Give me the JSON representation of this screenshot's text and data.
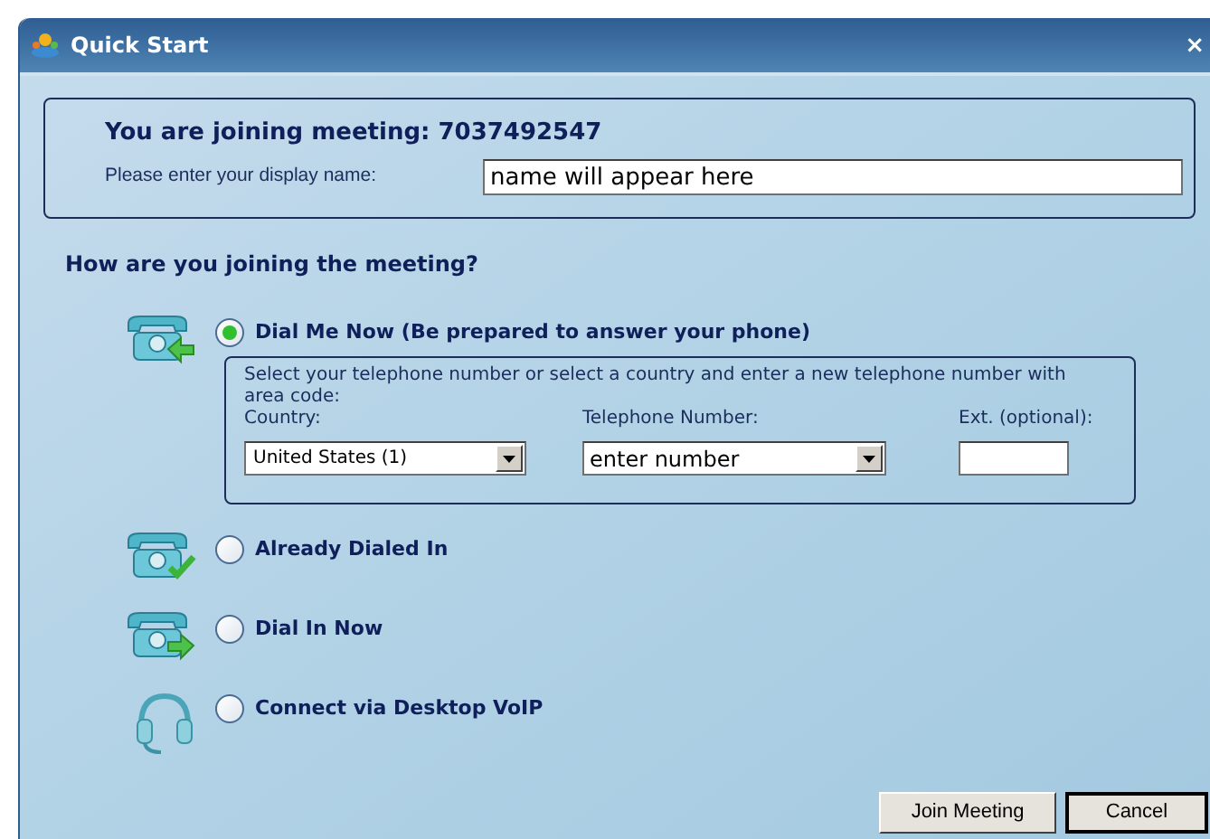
{
  "window": {
    "title": "Quick Start",
    "close": "×"
  },
  "meeting": {
    "heading": "You are joining meeting: 7037492547",
    "name_label": "Please enter your display name:",
    "name_value": "name will appear here"
  },
  "question": "How are you joining the meeting?",
  "options": [
    {
      "kind": "dial-me",
      "label": "Dial Me Now (Be prepared to answer your phone)",
      "selected": true,
      "details": {
        "instructions": "Select your telephone number or select a country and enter a new telephone number with area code:",
        "country_label": "Country:",
        "country_value": "United States (1)",
        "phone_label": "Telephone Number:",
        "phone_value": "enter number",
        "ext_label": "Ext. (optional):"
      }
    },
    {
      "kind": "dialed",
      "label": "Already Dialed In",
      "selected": false
    },
    {
      "kind": "dial-in",
      "label": "Dial In Now",
      "selected": false
    },
    {
      "kind": "voip",
      "label": "Connect via Desktop VoIP",
      "selected": false
    }
  ],
  "buttons": [
    {
      "label": "Join Meeting",
      "default": false
    },
    {
      "label": "Cancel",
      "default": true
    }
  ]
}
